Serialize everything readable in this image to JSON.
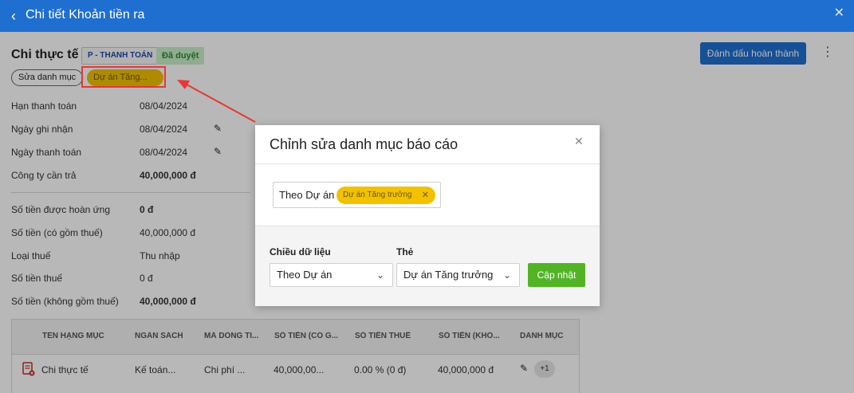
{
  "header": {
    "title": "Chi tiết Khoản tiền ra"
  },
  "page": {
    "title": "Chi thực tế",
    "badge_payment": "P - THANH TOÁN",
    "badge_status": "Đã duyệt",
    "mark_done_label": "Đánh dấu hoàn thành",
    "edit_category_label": "Sửa danh mục",
    "tag_label": "Dự án Tăng..."
  },
  "info": [
    {
      "label": "Hạn thanh toán",
      "value": "08/04/2024"
    },
    {
      "label": "Ngày ghi nhận",
      "value": "08/04/2024"
    },
    {
      "label": "Ngày thanh toán",
      "value": "08/04/2024"
    },
    {
      "label": "Công ty cần trả",
      "value": "40,000,000 đ"
    },
    {
      "label": "Số tiền được hoàn ứng",
      "value": "0 đ"
    },
    {
      "label": "Số tiền (có gồm thuế)",
      "value": "40,000,000 đ"
    },
    {
      "label": "Loại thuế",
      "value": "Thu nhập"
    },
    {
      "label": "Số tiền thuế",
      "value": "0 đ"
    },
    {
      "label": "Số tiền (không gồm thuế)",
      "value": "40,000,000 đ"
    }
  ],
  "table": {
    "columns": [
      "TÊN HẠNG MỤC",
      "NGÂN SÁCH",
      "MÃ DÒNG TI...",
      "SỐ TIỀN (CÓ G...",
      "SỐ TIỀN THUẾ",
      "SỐ TIỀN (KHÔ...",
      "DANH MỤC"
    ],
    "row": [
      "Chi thực tế",
      "Kế toán...",
      "Chi phí ...",
      "40,000,00...",
      "0.00 % (0 đ)",
      "40,000,000 đ",
      "+1"
    ]
  },
  "modal": {
    "title": "Chỉnh sửa danh mục báo cáo",
    "filter_label": "Theo Dự án",
    "filter_chip": "Dự án Tăng trưởng",
    "dimension_label": "Chiều dữ liệu",
    "dimension_value": "Theo Dự án",
    "tag_field_label": "Thẻ",
    "tag_field_value": "Dự án Tăng trưởng",
    "update_label": "Cập nhật"
  },
  "colors": {
    "primary": "#1f6fd1",
    "tag": "#f2c100",
    "success": "#52b425",
    "annotation": "#e53935"
  }
}
